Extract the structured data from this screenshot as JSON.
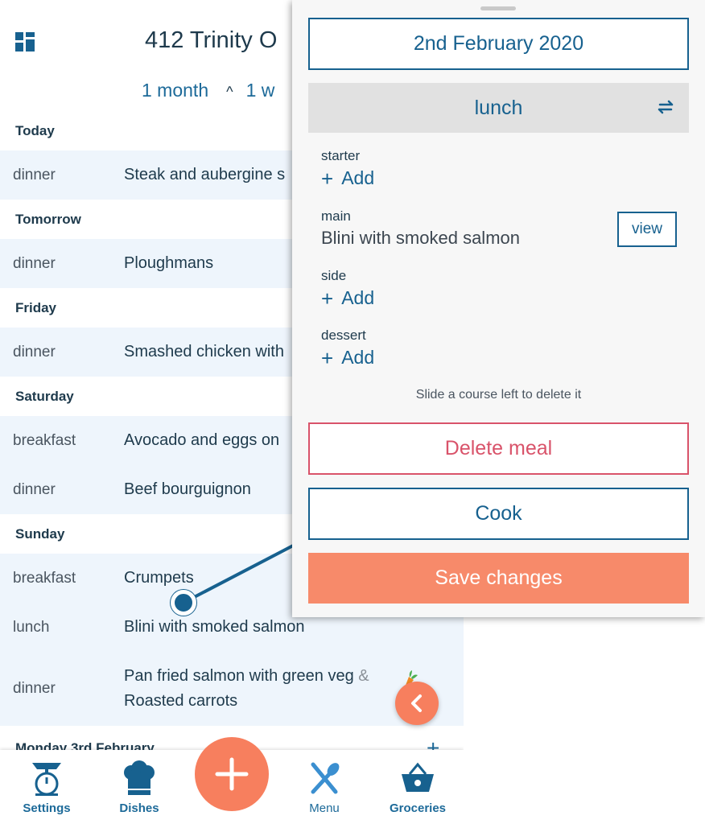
{
  "header": {
    "title": "412 Trinity O",
    "range_start": "1 month",
    "range_caret": "^",
    "range_end": "1 w"
  },
  "days": [
    {
      "label": "Today",
      "meals": [
        {
          "slot": "dinner",
          "dish": "Steak and aubergine s"
        }
      ]
    },
    {
      "label": "Tomorrow",
      "meals": [
        {
          "slot": "dinner",
          "dish": "Ploughmans"
        }
      ]
    },
    {
      "label": "Friday",
      "meals": [
        {
          "slot": "dinner",
          "dish": "Smashed chicken with"
        }
      ]
    },
    {
      "label": "Saturday",
      "meals": [
        {
          "slot": "breakfast",
          "dish": "Avocado and eggs on"
        },
        {
          "slot": "dinner",
          "dish": "Beef bourguignon"
        }
      ]
    },
    {
      "label": "Sunday",
      "meals": [
        {
          "slot": "breakfast",
          "dish": "Crumpets"
        },
        {
          "slot": "lunch",
          "dish": "Blini with smoked salmon"
        },
        {
          "slot": "dinner",
          "dish": "Pan fried salmon with green veg",
          "amp": "&",
          "dish2": "Roasted carrots"
        }
      ]
    }
  ],
  "next_day_header": "Monday 3rd February",
  "next_day_add": "+",
  "tabs": {
    "settings": "Settings",
    "dishes": "Dishes",
    "menu": "Menu",
    "groceries": "Groceries"
  },
  "editor": {
    "date": "2nd February 2020",
    "meal_type": "lunch",
    "courses": {
      "starter": {
        "name": "starter",
        "add": "Add"
      },
      "main": {
        "name": "main",
        "dish": "Blini with smoked salmon",
        "view": "view"
      },
      "side": {
        "name": "side",
        "add": "Add"
      },
      "dessert": {
        "name": "dessert",
        "add": "Add"
      }
    },
    "hint": "Slide a course left to delete it",
    "delete_label": "Delete meal",
    "cook_label": "Cook",
    "save_label": "Save changes"
  },
  "colors": {
    "accent_blue": "#17618f",
    "orange": "#f77f5e",
    "delete_red": "#d9536a",
    "row_bg": "#eef5fc"
  },
  "icons": {
    "grid": "grid-icon",
    "swap": "swap-icon",
    "back": "chevron-left-icon",
    "add": "plus-icon",
    "carrot": "carrot-icon",
    "settings": "scale-icon",
    "dishes": "chef-hat-icon",
    "menu": "cutlery-icon",
    "groceries": "basket-icon"
  }
}
